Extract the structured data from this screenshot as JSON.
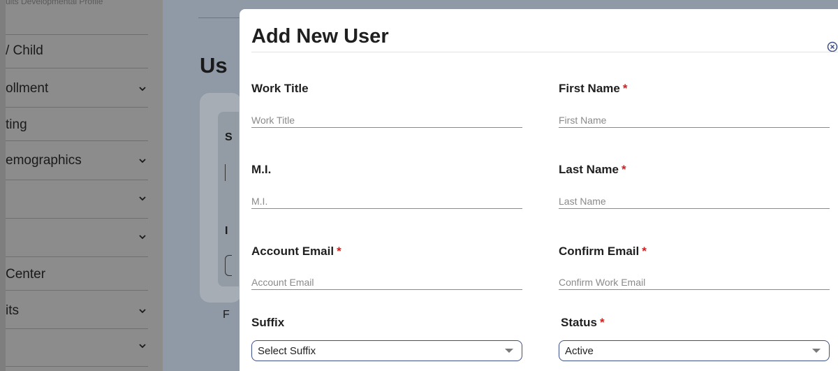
{
  "sidebar": {
    "top_text": "ults Developmental Profile",
    "items": [
      {
        "label": "/ Child",
        "chevron": false
      },
      {
        "label": "ollment",
        "chevron": true
      },
      {
        "label": "ting",
        "chevron": false
      },
      {
        "label": "emographics",
        "chevron": true
      },
      {
        "label": "",
        "chevron": true
      },
      {
        "label": "",
        "chevron": true
      },
      {
        "label": "Center",
        "chevron": false
      },
      {
        "label": "its",
        "chevron": true
      },
      {
        "label": "",
        "chevron": true
      }
    ]
  },
  "background": {
    "title": "Us",
    "s_label": "S",
    "r_label": "I",
    "f_label": "F"
  },
  "modal": {
    "title": "Add New User",
    "fields": {
      "work_title": {
        "label": "Work Title",
        "placeholder": "Work Title",
        "required": false
      },
      "first_name": {
        "label": "First Name",
        "placeholder": "First Name",
        "required": true
      },
      "mi": {
        "label": "M.I.",
        "placeholder": "M.I.",
        "required": false
      },
      "last_name": {
        "label": "Last Name",
        "placeholder": "Last Name",
        "required": true
      },
      "account_email": {
        "label": "Account Email",
        "placeholder": "Account Email",
        "required": true
      },
      "confirm_email": {
        "label": "Confirm Email",
        "placeholder": "Confirm Work Email",
        "required": true
      },
      "suffix": {
        "label": "Suffix",
        "value": "Select Suffix",
        "required": false
      },
      "status": {
        "label": "Status",
        "value": "Active",
        "required": true
      }
    },
    "required_marker": "*"
  },
  "colors": {
    "required": "#d21f1f",
    "select_border": "#3d4f8a",
    "overlay_sidebar": "#8c8c8c",
    "overlay_page": "#8f9aa6"
  }
}
